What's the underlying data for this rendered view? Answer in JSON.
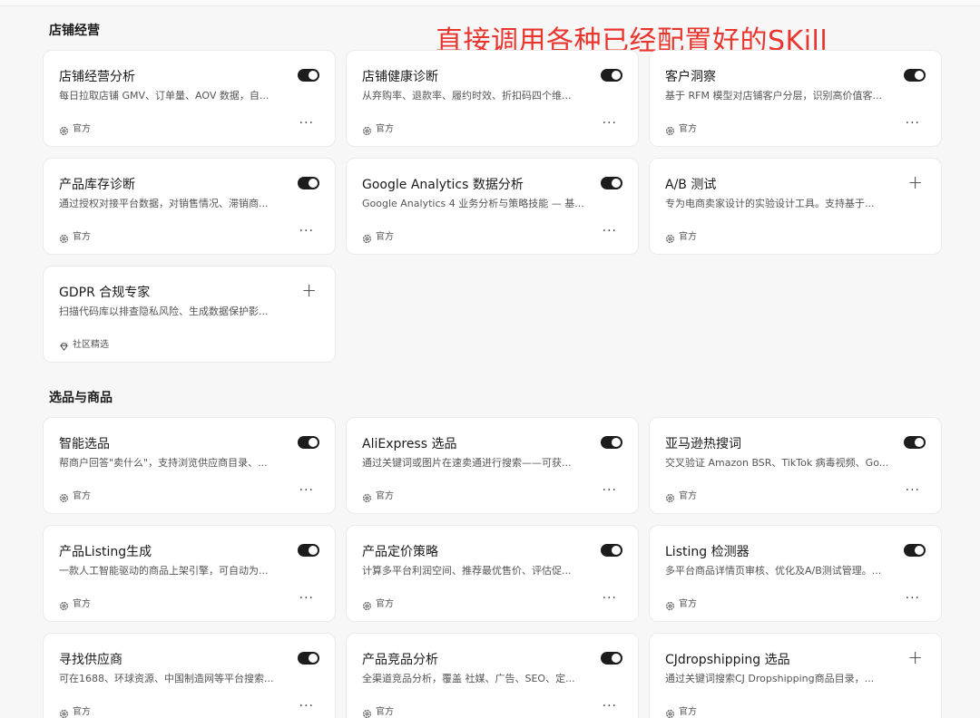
{
  "annotation": "直接调用各种已经配置好的SKill",
  "sections": [
    {
      "title": "店铺经营",
      "cards": [
        {
          "title": "店铺经营分析",
          "desc": "每日拉取店铺 GMV、订单量、AOV 数据，自...",
          "tag": "官方",
          "tag_icon": "gear-icon",
          "state": "on",
          "more": "···"
        },
        {
          "title": "店铺健康诊断",
          "desc": "从弃购率、退款率、履约时效、折扣码四个维...",
          "tag": "官方",
          "tag_icon": "gear-icon",
          "state": "on",
          "more": "···"
        },
        {
          "title": "客户洞察",
          "desc": "基于 RFM 模型对店铺客户分层，识别高价值客...",
          "tag": "官方",
          "tag_icon": "gear-icon",
          "state": "on",
          "more": "···"
        },
        {
          "title": "产品库存诊断",
          "desc": "通过授权对接平台数据，对销售情况、滞销商...",
          "tag": "官方",
          "tag_icon": "gear-icon",
          "state": "on",
          "more": "···"
        },
        {
          "title": "Google Analytics 数据分析",
          "desc": "Google Analytics 4 业务分析与策略技能 — 基...",
          "tag": "官方",
          "tag_icon": "gear-icon",
          "state": "on",
          "more": "···"
        },
        {
          "title": "A/B 测试",
          "desc": "专为电商卖家设计的实验设计工具。支持基于...",
          "tag": "官方",
          "tag_icon": "gear-icon",
          "state": "add",
          "more": ""
        },
        {
          "title": "GDPR 合规专家",
          "desc": "扫描代码库以排查隐私风险、生成数据保护影...",
          "tag": "社区精选",
          "tag_icon": "diamond-icon",
          "state": "add",
          "more": ""
        }
      ]
    },
    {
      "title": "选品与商品",
      "cards": [
        {
          "title": "智能选品",
          "desc": "帮商户回答\"卖什么\"，支持浏览供应商目录、...",
          "tag": "官方",
          "tag_icon": "gear-icon",
          "state": "on",
          "more": "···"
        },
        {
          "title": "AliExpress 选品",
          "desc": "通过关键词或图片在速卖通进行搜索——可获...",
          "tag": "官方",
          "tag_icon": "gear-icon",
          "state": "on",
          "more": "···"
        },
        {
          "title": "亚马逊热搜词",
          "desc": "交叉验证 Amazon BSR、TikTok 病毒视频、Go...",
          "tag": "官方",
          "tag_icon": "gear-icon",
          "state": "on",
          "more": "···"
        },
        {
          "title": "产品Listing生成",
          "desc": "一款人工智能驱动的商品上架引擎，可自动为...",
          "tag": "官方",
          "tag_icon": "gear-icon",
          "state": "on",
          "more": "···"
        },
        {
          "title": "产品定价策略",
          "desc": "计算多平台利润空间、推荐最优售价、评估促...",
          "tag": "官方",
          "tag_icon": "gear-icon",
          "state": "on",
          "more": "···"
        },
        {
          "title": "Listing 检测器",
          "desc": "多平台商品详情页审核、优化及A/B测试管理。...",
          "tag": "官方",
          "tag_icon": "gear-icon",
          "state": "on",
          "more": "···"
        },
        {
          "title": "寻找供应商",
          "desc": "可在1688、环球资源、中国制造网等平台搜索...",
          "tag": "官方",
          "tag_icon": "gear-icon",
          "state": "on",
          "more": "···"
        },
        {
          "title": "产品竞品分析",
          "desc": "全渠道竞品分析，覆盖 社媒、广告、SEO、定...",
          "tag": "官方",
          "tag_icon": "gear-icon",
          "state": "on",
          "more": "···"
        },
        {
          "title": "CJdropshipping 选品",
          "desc": "通过关键词搜索CJ Dropshipping商品目录，...",
          "tag": "官方",
          "tag_icon": "gear-icon",
          "state": "add",
          "more": ""
        }
      ]
    }
  ],
  "plus_symbol": "+",
  "colors": {
    "annotation": "#e8362f",
    "toggle_on": "#1c1c1c",
    "card_bg": "#ffffff",
    "page_bg": "#f7f7f7"
  }
}
